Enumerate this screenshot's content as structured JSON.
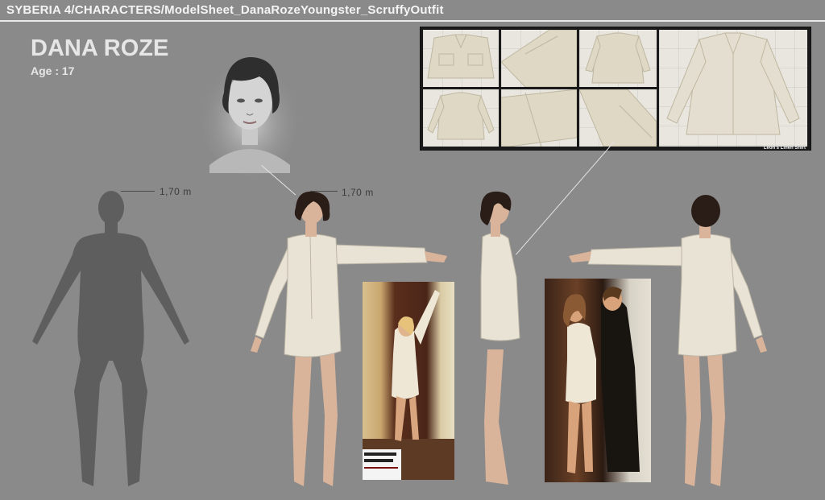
{
  "header": {
    "path": "SYBERIA 4/CHARACTERS/ModelSheet_DanaRozeYoungster_ScruffyOutfit"
  },
  "character": {
    "name": "DANA ROZE",
    "age": "Age : 17"
  },
  "measurements": {
    "silhouette_height": "1,70 m",
    "front_height": "1,70 m"
  },
  "reference_board": {
    "caption": "Leon's Linen Shirt"
  },
  "colors": {
    "background": "#8a8a8a",
    "silhouette": "#5e5e5e",
    "shirt": "#e9e3d6",
    "skin": "#d9b49a",
    "hair": "#2a1c16"
  }
}
